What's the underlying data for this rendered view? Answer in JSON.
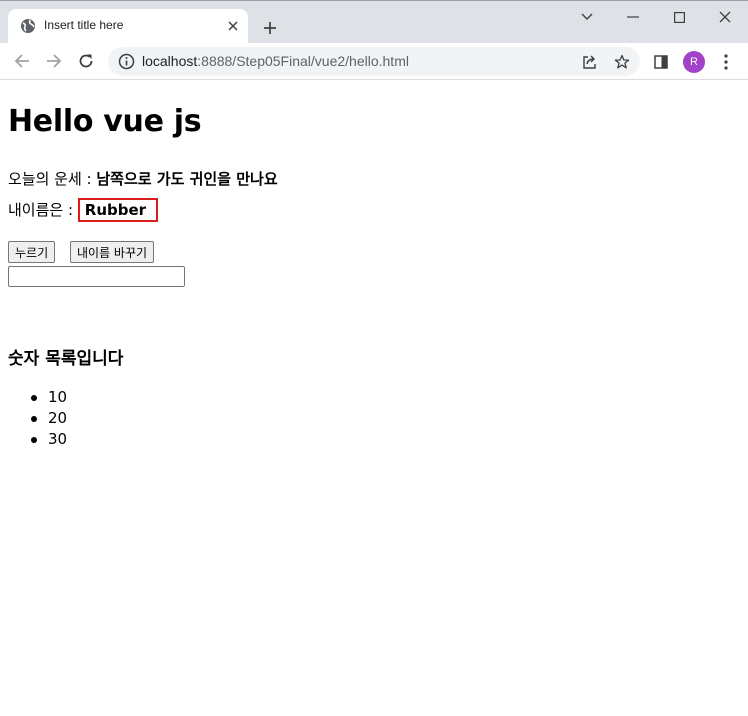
{
  "browser": {
    "tab_title": "Insert title here",
    "url_host": "localhost",
    "url_rest": ":8888/Step05Final/vue2/hello.html",
    "profile_initial": "R",
    "profile_color": "#a142c9"
  },
  "page": {
    "heading": "Hello vue js",
    "fortune_label": "오늘의 운세 : ",
    "fortune_value": "남쪽으로 가도 귀인을 만나요",
    "name_label": "내이름은 : ",
    "name_value": "Rubber",
    "press_button": "누르기",
    "change_name_button": "내이름 바꾸기",
    "text_input_value": "",
    "list_heading": "숫자 목록입니다",
    "numbers": [
      "10",
      "20",
      "30"
    ]
  },
  "colors": {
    "highlight_border": "#d91e1e",
    "tabstrip_bg": "#dee1e6",
    "omnibox_bg": "#f1f3f4"
  }
}
